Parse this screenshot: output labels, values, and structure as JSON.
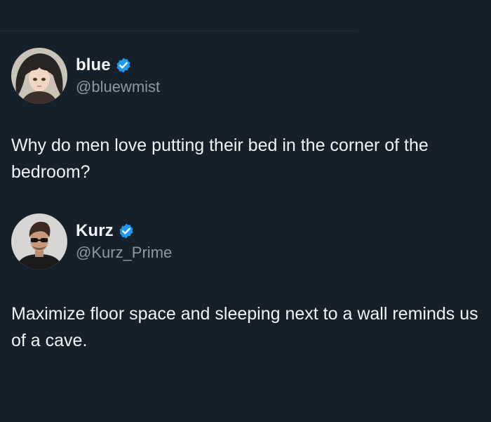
{
  "posts": [
    {
      "display_name": "blue",
      "handle": "@bluewmist",
      "verified_icon": "verified-badge-icon",
      "text": "Why do men love putting their bed in the corner of the bedroom?"
    },
    {
      "display_name": "Kurz",
      "handle": "@Kurz_Prime",
      "verified_icon": "verified-badge-icon",
      "text": "Maximize floor space and sleeping next to a wall reminds us of a cave."
    }
  ],
  "colors": {
    "background": "#15202b",
    "text": "#f2f4f5",
    "secondary_text": "#8b98a5",
    "verified_blue": "#1d9bf0"
  }
}
